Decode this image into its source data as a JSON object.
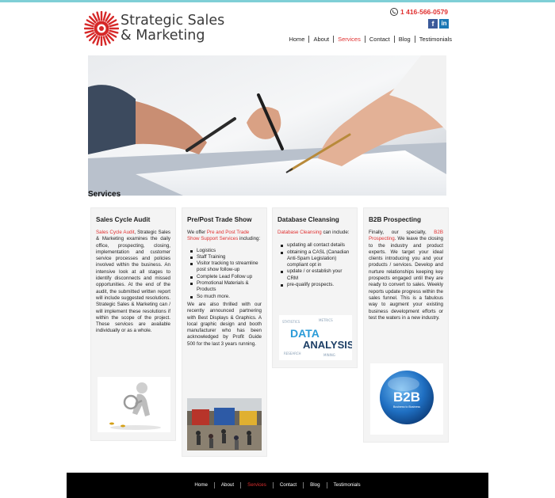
{
  "brand": {
    "line1": "Strategic Sales",
    "line2": "& Marketing",
    "accent": "#e03030"
  },
  "contact": {
    "phone": "1 416-566-0579"
  },
  "social": [
    "facebook-icon",
    "linkedin-icon"
  ],
  "nav": {
    "items": [
      "Home",
      "About",
      "Services",
      "Contact",
      "Blog",
      "Testimonials"
    ],
    "active": "Services"
  },
  "page": {
    "title": "Services"
  },
  "cards": [
    {
      "title": "Sales Cycle Audit",
      "lead": "Sales Cycle Audit",
      "body": ", Strategic Sales & Marketing examines the daily office, prospecting, closing, implementation and customer service processes and policies involved within the business. An intensive look at all stages to identify disconnects and missed opportunities. At the end of the audit, the submitted written report will include suggested resolutions. Strategic Sales & Marketing can / will implement these resolutions if within the scope of the project. These services are available individually or as a whole."
    },
    {
      "title": "Pre/Post Trade Show",
      "intro": "We offer ",
      "lead": "Pre and Post Trade Show Support Services",
      "intro_end": " including:",
      "bullets": [
        "Logistics",
        "Staff Training",
        "Visitor tracking to streamline post show follow-up",
        "Complete Lead Follow up",
        "Promotional Materials & Products",
        "So much more."
      ],
      "body": "We are also thrilled with our recently announced partnering with Best Displays & Graphics. A local graphic design and booth manufacturer who has been acknowledged by Profit Guide 500 for the last 3 years running."
    },
    {
      "title": "Database Cleansing",
      "lead": "Database Cleansing",
      "intro_end": " can include:",
      "bullets": [
        "updating all contact details",
        "obtaining a CASL (Canadian Anti-Spam Legislation) compliant opt in",
        "update / or establish your CRM",
        "pre-qualify prospects."
      ],
      "wordcloud": {
        "word1": "DATA",
        "word2": "ANALYSIS"
      }
    },
    {
      "title": "B2B Prospecting",
      "intro": "Finally, our specialty, ",
      "lead": "B2B Prospecting",
      "body": ". We leave the closing to the industry and product experts. We target your ideal clients introducing you and your products / services. Develop and nurture relationships keeping key prospects engaged until they are ready to convert to sales. Weekly reports update progress within the sales funnel. This is a fabulous way to augment your existing business development efforts or test the waters in a new industry.",
      "badge": {
        "big": "B2B",
        "small": "Business to Business"
      }
    }
  ],
  "footer": {
    "items": [
      "Home",
      "About",
      "Services",
      "Contact",
      "Blog",
      "Testimonials"
    ],
    "active": "Services"
  }
}
